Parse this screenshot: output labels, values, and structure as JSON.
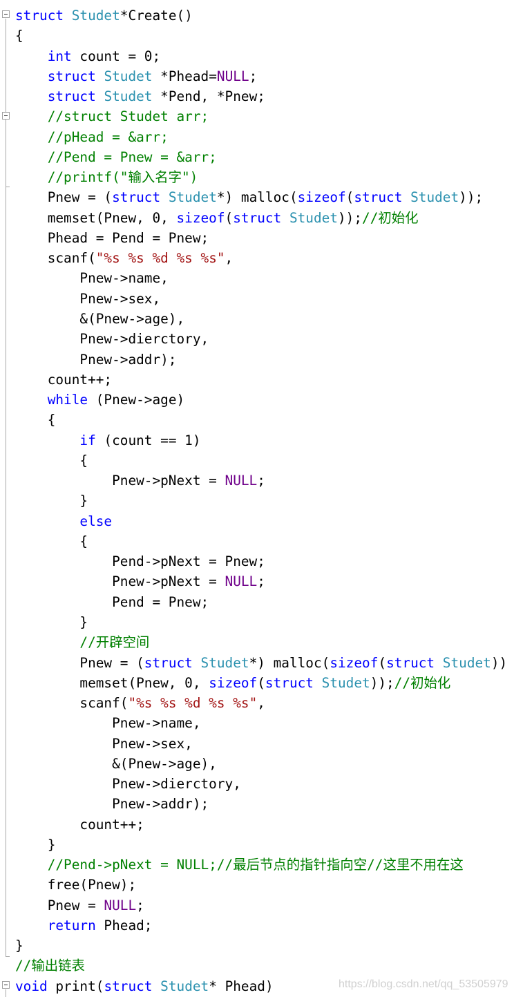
{
  "colors": {
    "keyword": "#0000ff",
    "type": "#2b91af",
    "comment": "#008000",
    "string": "#a31515",
    "macro": "#6f008a",
    "plain": "#000000"
  },
  "watermark": "https://blog.csdn.net/qq_53505979",
  "lines": [
    [
      [
        "kw",
        "struct"
      ],
      [
        "pl",
        " "
      ],
      [
        "ty",
        "Studet"
      ],
      [
        "pl",
        "*Create()"
      ]
    ],
    [
      [
        "pl",
        "{"
      ]
    ],
    [
      [
        "pl",
        "    "
      ],
      [
        "kw",
        "int"
      ],
      [
        "pl",
        " count = 0;"
      ]
    ],
    [
      [
        "pl",
        "    "
      ],
      [
        "kw",
        "struct"
      ],
      [
        "pl",
        " "
      ],
      [
        "ty",
        "Studet"
      ],
      [
        "pl",
        " *Phead="
      ],
      [
        "mac",
        "NULL"
      ],
      [
        "pl",
        ";"
      ]
    ],
    [
      [
        "pl",
        "    "
      ],
      [
        "kw",
        "struct"
      ],
      [
        "pl",
        " "
      ],
      [
        "ty",
        "Studet"
      ],
      [
        "pl",
        " *Pend, *Pnew;"
      ]
    ],
    [
      [
        "cm",
        "    //struct Studet arr;"
      ]
    ],
    [
      [
        "cm",
        "    //pHead = &arr;"
      ]
    ],
    [
      [
        "cm",
        "    //Pend = Pnew = &arr;"
      ]
    ],
    [
      [
        "cm",
        "    //printf(\"输入名字\")"
      ]
    ],
    [
      [
        "pl",
        "    Pnew = ("
      ],
      [
        "kw",
        "struct"
      ],
      [
        "pl",
        " "
      ],
      [
        "ty",
        "Studet"
      ],
      [
        "pl",
        "*) malloc("
      ],
      [
        "kw",
        "sizeof"
      ],
      [
        "pl",
        "("
      ],
      [
        "kw",
        "struct"
      ],
      [
        "pl",
        " "
      ],
      [
        "ty",
        "Studet"
      ],
      [
        "pl",
        "));"
      ]
    ],
    [
      [
        "pl",
        "    memset(Pnew, 0, "
      ],
      [
        "kw",
        "sizeof"
      ],
      [
        "pl",
        "("
      ],
      [
        "kw",
        "struct"
      ],
      [
        "pl",
        " "
      ],
      [
        "ty",
        "Studet"
      ],
      [
        "pl",
        "));"
      ],
      [
        "cm",
        "//初始化"
      ]
    ],
    [
      [
        "pl",
        "    Phead = Pend = Pnew;"
      ]
    ],
    [
      [
        "pl",
        "    scanf("
      ],
      [
        "st",
        "\"%s %s %d %s %s\""
      ],
      [
        "pl",
        ","
      ]
    ],
    [
      [
        "pl",
        "        Pnew->name,"
      ]
    ],
    [
      [
        "pl",
        "        Pnew->sex,"
      ]
    ],
    [
      [
        "pl",
        "        &(Pnew->age),"
      ]
    ],
    [
      [
        "pl",
        "        Pnew->dierctory,"
      ]
    ],
    [
      [
        "pl",
        "        Pnew->addr);"
      ]
    ],
    [
      [
        "pl",
        "    count++;"
      ]
    ],
    [
      [
        "pl",
        "    "
      ],
      [
        "kw",
        "while"
      ],
      [
        "pl",
        " (Pnew->age)"
      ]
    ],
    [
      [
        "pl",
        "    {"
      ]
    ],
    [
      [
        "pl",
        "        "
      ],
      [
        "kw",
        "if"
      ],
      [
        "pl",
        " (count == 1)"
      ]
    ],
    [
      [
        "pl",
        "        {"
      ]
    ],
    [
      [
        "pl",
        "            Pnew->pNext = "
      ],
      [
        "mac",
        "NULL"
      ],
      [
        "pl",
        ";"
      ]
    ],
    [
      [
        "pl",
        "        }"
      ]
    ],
    [
      [
        "pl",
        "        "
      ],
      [
        "kw",
        "else"
      ]
    ],
    [
      [
        "pl",
        "        {"
      ]
    ],
    [
      [
        "pl",
        "            Pend->pNext = Pnew;"
      ]
    ],
    [
      [
        "pl",
        "            Pnew->pNext = "
      ],
      [
        "mac",
        "NULL"
      ],
      [
        "pl",
        ";"
      ]
    ],
    [
      [
        "pl",
        "            Pend = Pnew;"
      ]
    ],
    [
      [
        "pl",
        "        }"
      ]
    ],
    [
      [
        "cm",
        "        //开辟空间"
      ]
    ],
    [
      [
        "pl",
        "        Pnew = ("
      ],
      [
        "kw",
        "struct"
      ],
      [
        "pl",
        " "
      ],
      [
        "ty",
        "Studet"
      ],
      [
        "pl",
        "*) malloc("
      ],
      [
        "kw",
        "sizeof"
      ],
      [
        "pl",
        "("
      ],
      [
        "kw",
        "struct"
      ],
      [
        "pl",
        " "
      ],
      [
        "ty",
        "Studet"
      ],
      [
        "pl",
        "))"
      ]
    ],
    [
      [
        "pl",
        "        memset(Pnew, 0, "
      ],
      [
        "kw",
        "sizeof"
      ],
      [
        "pl",
        "("
      ],
      [
        "kw",
        "struct"
      ],
      [
        "pl",
        " "
      ],
      [
        "ty",
        "Studet"
      ],
      [
        "pl",
        "));"
      ],
      [
        "cm",
        "//初始化"
      ]
    ],
    [
      [
        "pl",
        "        scanf("
      ],
      [
        "st",
        "\"%s %s %d %s %s\""
      ],
      [
        "pl",
        ","
      ]
    ],
    [
      [
        "pl",
        "            Pnew->name,"
      ]
    ],
    [
      [
        "pl",
        "            Pnew->sex,"
      ]
    ],
    [
      [
        "pl",
        "            &(Pnew->age),"
      ]
    ],
    [
      [
        "pl",
        "            Pnew->dierctory,"
      ]
    ],
    [
      [
        "pl",
        "            Pnew->addr);"
      ]
    ],
    [
      [
        "pl",
        "        count++;"
      ]
    ],
    [
      [
        "pl",
        "    }"
      ]
    ],
    [
      [
        "cm",
        "    //Pend->pNext = NULL;//最后节点的指针指向空//这里不用在这"
      ]
    ],
    [
      [
        "pl",
        "    free(Pnew);"
      ]
    ],
    [
      [
        "pl",
        "    Pnew = "
      ],
      [
        "mac",
        "NULL"
      ],
      [
        "pl",
        ";"
      ]
    ],
    [
      [
        "pl",
        "    "
      ],
      [
        "kw",
        "return"
      ],
      [
        "pl",
        " Phead;"
      ]
    ],
    [
      [
        "pl",
        "}"
      ]
    ],
    [
      [
        "cm",
        "//输出链表"
      ]
    ],
    [
      [
        "kw",
        "void"
      ],
      [
        "pl",
        " print("
      ],
      [
        "kw",
        "struct"
      ],
      [
        "pl",
        " "
      ],
      [
        "ty",
        "Studet"
      ],
      [
        "pl",
        "* Phead)"
      ]
    ]
  ]
}
